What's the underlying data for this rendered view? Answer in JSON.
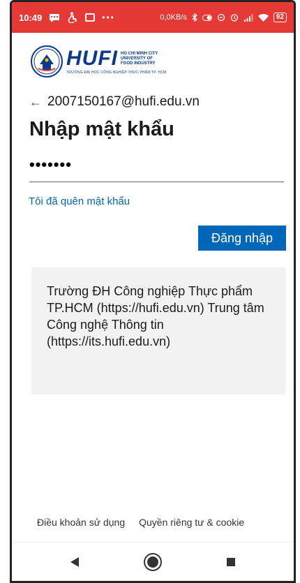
{
  "status_bar": {
    "time": "10:49",
    "left_icons": [
      "message-icon",
      "accessibility-icon",
      "box-icon",
      "more-dots-icon"
    ],
    "network_speed": "0,0KB/s",
    "battery": "92"
  },
  "logo": {
    "name": "HUFI",
    "subtitle_lines": [
      "HO CHI MINH CITY",
      "UNIVERSITY OF",
      "FOOD INDUSTRY"
    ],
    "tagline": "TRƯỜNG ĐẠI HỌC CÔNG NGHIỆP THỰC PHẨM TP. HCM"
  },
  "account": {
    "back_icon": "left-arrow-icon",
    "email": "2007150167@hufi.edu.vn"
  },
  "page": {
    "title": "Nhập mật khẩu"
  },
  "form": {
    "password_value": "•••••••",
    "forgot_label": "Tôi đã quên mật khẩu",
    "signin_label": "Đăng nhập"
  },
  "info": {
    "text": "Trường ĐH Công nghiệp Thực phẩm TP.HCM (https://hufi.edu.vn) Trung tâm Công nghệ Thông tin (https://its.hufi.edu.vn)"
  },
  "footer": {
    "terms_label": "Điều khoản sử dụng",
    "privacy_label": "Quyền riêng tư & cookie",
    "more_label": "..."
  },
  "nav": {
    "back": "back-icon",
    "home": "home-icon",
    "recent": "recents-icon"
  },
  "colors": {
    "status_bar": "#e53935",
    "primary": "#0067b8",
    "info_bg": "#f2f2f2",
    "logo_blue": "#0b3a8c"
  }
}
